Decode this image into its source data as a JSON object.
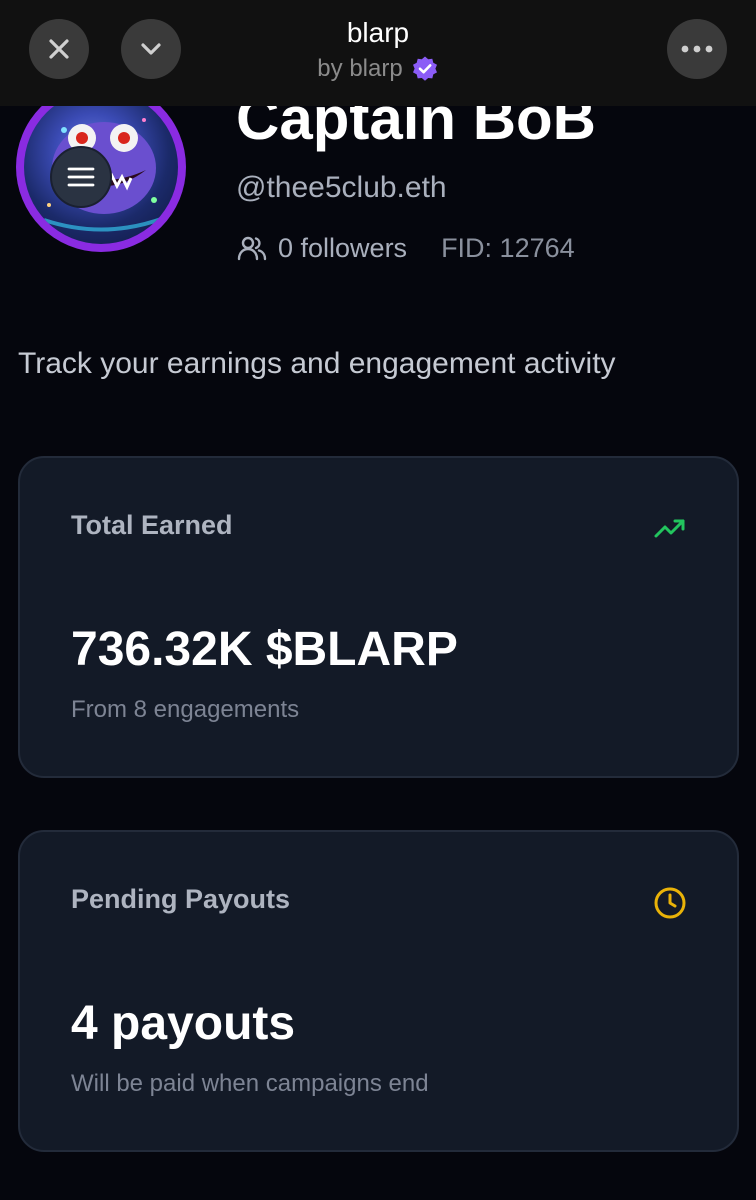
{
  "topbar": {
    "title": "blarp",
    "subtitle": "by blarp",
    "icons": {
      "close": "close-icon",
      "collapse": "chevron-down-icon",
      "more": "more-horizontal-icon",
      "verified": "verified-badge-icon"
    }
  },
  "profile": {
    "name": "Captain BoB",
    "handle": "@thee5club.eth",
    "followers": "0 followers",
    "fid": "FID: 12764",
    "avatar_ring_color": "#8a2be2"
  },
  "tagline": "Track your earnings and engagement activity",
  "cards": {
    "earned": {
      "label": "Total Earned",
      "value": "736.32K $BLARP",
      "sub": "From 8 engagements",
      "icon": "trending-up-icon",
      "icon_color": "#22c55e"
    },
    "pending": {
      "label": "Pending Payouts",
      "value": "4 payouts",
      "sub": "Will be paid when campaigns end",
      "icon": "clock-icon",
      "icon_color": "#eab308"
    }
  },
  "colors": {
    "accent": "#8b5cf6",
    "background": "#05060d",
    "card": "#131a27"
  }
}
